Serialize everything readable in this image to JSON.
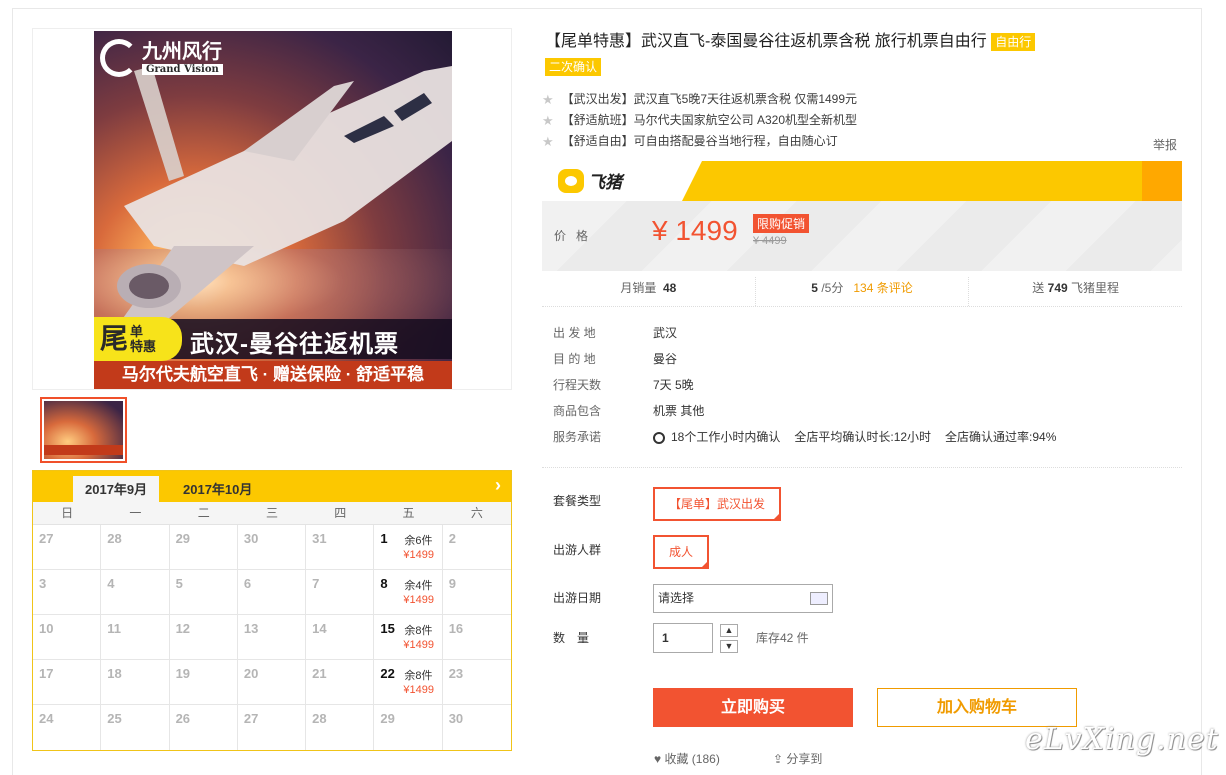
{
  "product": {
    "title": "【尾单特惠】武汉直飞-泰国曼谷往返机票含税 旅行机票自由行",
    "title_tag": "自由行",
    "confirm_tag": "二次确认",
    "bullets": [
      "【武汉出发】武汉直飞5晚7天往返机票含税 仅需1499元",
      "【舒适航班】马尔代夫国家航空公司 A320机型全新机型",
      "【舒适自由】可自由搭配曼谷当地行程，自由随心订"
    ],
    "report": "举报"
  },
  "poster": {
    "logo_text": "九州风行",
    "logo_sub": "Grand Vision",
    "badge_big": "尾",
    "badge_small_1": "单",
    "badge_small_2": "特惠",
    "route": "武汉-曼谷往返机票",
    "tagline": "马尔代夫航空直飞 · 赠送保险 · 舒适平稳"
  },
  "calendar": {
    "tabs": [
      "2017年9月",
      "2017年10月"
    ],
    "next_icon": "chevron-right-icon",
    "weekdays": [
      "日",
      "一",
      "二",
      "三",
      "四",
      "五",
      "六"
    ],
    "cells": [
      {
        "d": "27",
        "stock": "",
        "price": ""
      },
      {
        "d": "28",
        "stock": "",
        "price": ""
      },
      {
        "d": "29",
        "stock": "",
        "price": ""
      },
      {
        "d": "30",
        "stock": "",
        "price": ""
      },
      {
        "d": "31",
        "stock": "",
        "price": ""
      },
      {
        "d": "1",
        "stock": "余6件",
        "price": "¥1499"
      },
      {
        "d": "2",
        "stock": "",
        "price": ""
      },
      {
        "d": "3",
        "stock": "",
        "price": ""
      },
      {
        "d": "4",
        "stock": "",
        "price": ""
      },
      {
        "d": "5",
        "stock": "",
        "price": ""
      },
      {
        "d": "6",
        "stock": "",
        "price": ""
      },
      {
        "d": "7",
        "stock": "",
        "price": ""
      },
      {
        "d": "8",
        "stock": "余4件",
        "price": "¥1499"
      },
      {
        "d": "9",
        "stock": "",
        "price": ""
      },
      {
        "d": "10",
        "stock": "",
        "price": ""
      },
      {
        "d": "11",
        "stock": "",
        "price": ""
      },
      {
        "d": "12",
        "stock": "",
        "price": ""
      },
      {
        "d": "13",
        "stock": "",
        "price": ""
      },
      {
        "d": "14",
        "stock": "",
        "price": ""
      },
      {
        "d": "15",
        "stock": "余8件",
        "price": "¥1499"
      },
      {
        "d": "16",
        "stock": "",
        "price": ""
      },
      {
        "d": "17",
        "stock": "",
        "price": ""
      },
      {
        "d": "18",
        "stock": "",
        "price": ""
      },
      {
        "d": "19",
        "stock": "",
        "price": ""
      },
      {
        "d": "20",
        "stock": "",
        "price": ""
      },
      {
        "d": "21",
        "stock": "",
        "price": ""
      },
      {
        "d": "22",
        "stock": "余8件",
        "price": "¥1499"
      },
      {
        "d": "23",
        "stock": "",
        "price": ""
      },
      {
        "d": "24",
        "stock": "",
        "price": ""
      },
      {
        "d": "25",
        "stock": "",
        "price": ""
      },
      {
        "d": "26",
        "stock": "",
        "price": ""
      },
      {
        "d": "27",
        "stock": "",
        "price": ""
      },
      {
        "d": "28",
        "stock": "",
        "price": ""
      },
      {
        "d": "29",
        "stock": "",
        "price": ""
      },
      {
        "d": "30",
        "stock": "",
        "price": ""
      }
    ]
  },
  "brand": {
    "name": "飞猪"
  },
  "price": {
    "label": "价格",
    "current": "¥ 1499",
    "promo": "限购促销",
    "original": "¥ 4499"
  },
  "stats": {
    "sales_label": "月销量",
    "sales_value": "48",
    "rating_value": "5",
    "rating_suffix": "/5分",
    "reviews": "134 条评论",
    "miles_prefix": "送",
    "miles_value": "749",
    "miles_suffix": "飞猪里程"
  },
  "info": [
    {
      "k": "出 发 地",
      "v": "武汉"
    },
    {
      "k": "目 的 地",
      "v": "曼谷"
    },
    {
      "k": "行程天数",
      "v": "7天 5晚"
    },
    {
      "k": "商品包含",
      "v": "机票  其他"
    }
  ],
  "service": {
    "k": "服务承诺",
    "items": [
      "18个工作小时内确认",
      "全店平均确认时长:12小时",
      "全店确认通过率:94%"
    ]
  },
  "options": {
    "package_label": "套餐类型",
    "package_value": "【尾单】武汉出发",
    "people_label": "出游人群",
    "people_value": "成人",
    "date_label": "出游日期",
    "date_placeholder": "请选择",
    "qty_label": "数　量",
    "qty_value": "1",
    "stock": "库存42 件"
  },
  "actions": {
    "buy": "立即购买",
    "cart": "加入购物车",
    "fav": "收藏 (186)",
    "share": "分享到"
  },
  "watermark": "eLvXing.net"
}
